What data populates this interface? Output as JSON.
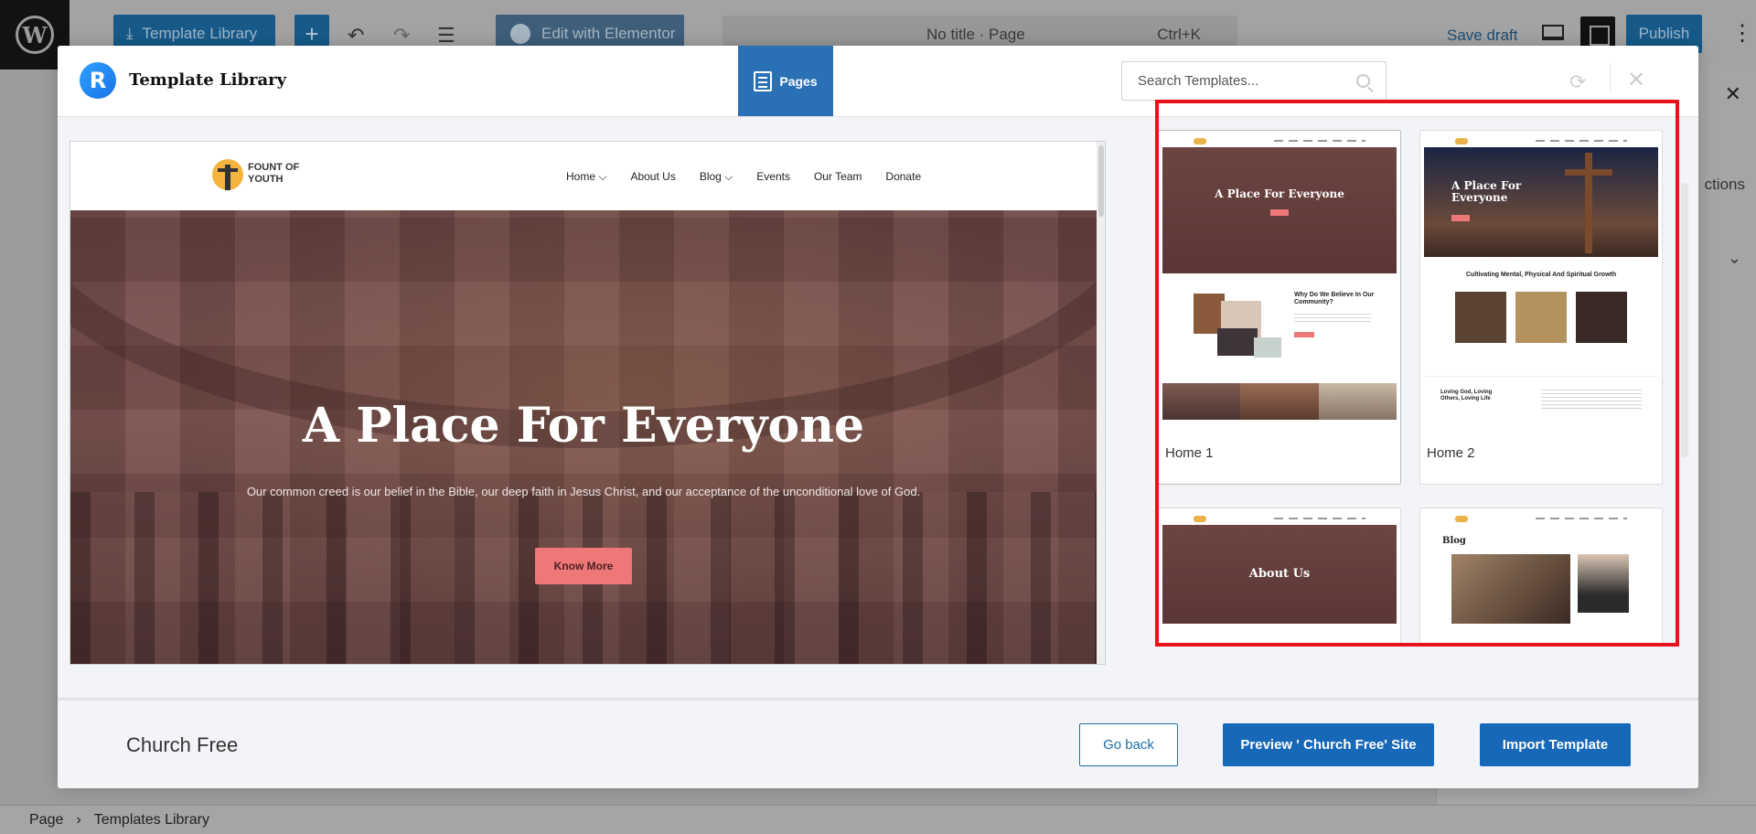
{
  "editor": {
    "template_library_btn": "Template Library",
    "add_icon": "+",
    "undo_icon": "↶",
    "redo_icon": "↷",
    "list_icon": "☰",
    "edit_with_elementor": "Edit with Elementor",
    "doc_title": "No title · Page",
    "shortcut": "Ctrl+K",
    "save_draft": "Save draft",
    "publish": "Publish",
    "more_icon": "⋮",
    "sidebar_close_icon": "✕",
    "sidebar_partial_text": "ctions",
    "sidebar_chevron": "⌄",
    "breadcrumb": [
      "Page",
      "Templates Library"
    ],
    "breadcrumb_sep": "›"
  },
  "modal": {
    "title": "Template Library",
    "logo_letter": "R",
    "tab_pages": "Pages",
    "search_placeholder": "Search Templates...",
    "sync_icon": "⟳",
    "close_icon": "✕"
  },
  "preview": {
    "logo_text": "FOUNT OF YOUTH",
    "menu": [
      "Home ⌵",
      "About Us",
      "Blog ⌵",
      "Events",
      "Our Team",
      "Donate"
    ],
    "hero_title": "A Place For Everyone",
    "hero_subtitle": "Our common creed is our belief in the Bible, our deep faith in Jesus Christ, and our acceptance of the unconditional love of God.",
    "hero_button": "Know More"
  },
  "templates": [
    {
      "label": "Home 1",
      "thumb_title": "A Place For Everyone",
      "thumb_heading": "Why Do We Believe In Our Community?"
    },
    {
      "label": "Home 2",
      "thumb_title": "A Place For Everyone",
      "thumb_heading": "Cultivating Mental, Physical And Spiritual Growth",
      "thumb_bottom": "Loving God, Loving Others, Loving Life"
    },
    {
      "label": "About Us",
      "thumb_title": "About Us"
    },
    {
      "label": "Blog",
      "thumb_title": "Blog"
    }
  ],
  "footer": {
    "template_name": "Church Free",
    "go_back": "Go back",
    "preview_site": "Preview ' Church Free' Site",
    "import_template": "Import Template"
  },
  "colors": {
    "accent": "#1768b8",
    "highlight_frame": "#e8121b",
    "hero_button": "#ee7778"
  }
}
